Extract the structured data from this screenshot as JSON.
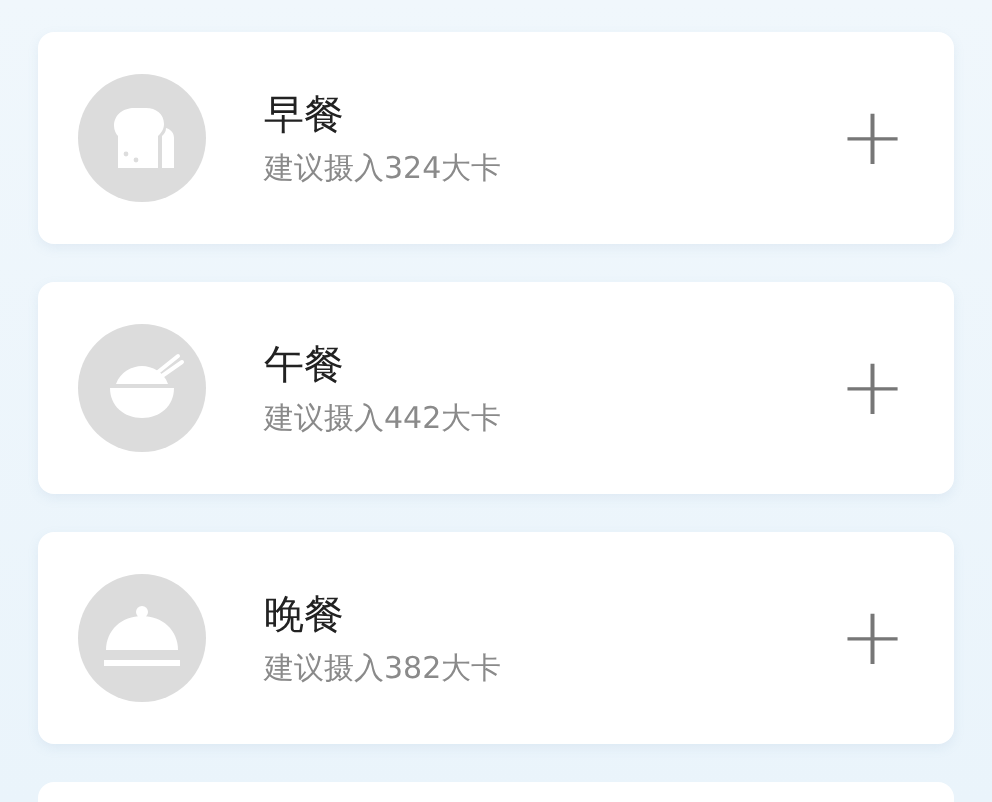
{
  "meals": [
    {
      "kind": "toast",
      "title": "早餐",
      "hint": "建议摄入324大卡",
      "action": "+"
    },
    {
      "kind": "bowl",
      "title": "午餐",
      "hint": "建议摄入442大卡",
      "action": "+"
    },
    {
      "kind": "cloche",
      "title": "晚餐",
      "hint": "建议摄入382大卡",
      "action": "+"
    }
  ]
}
